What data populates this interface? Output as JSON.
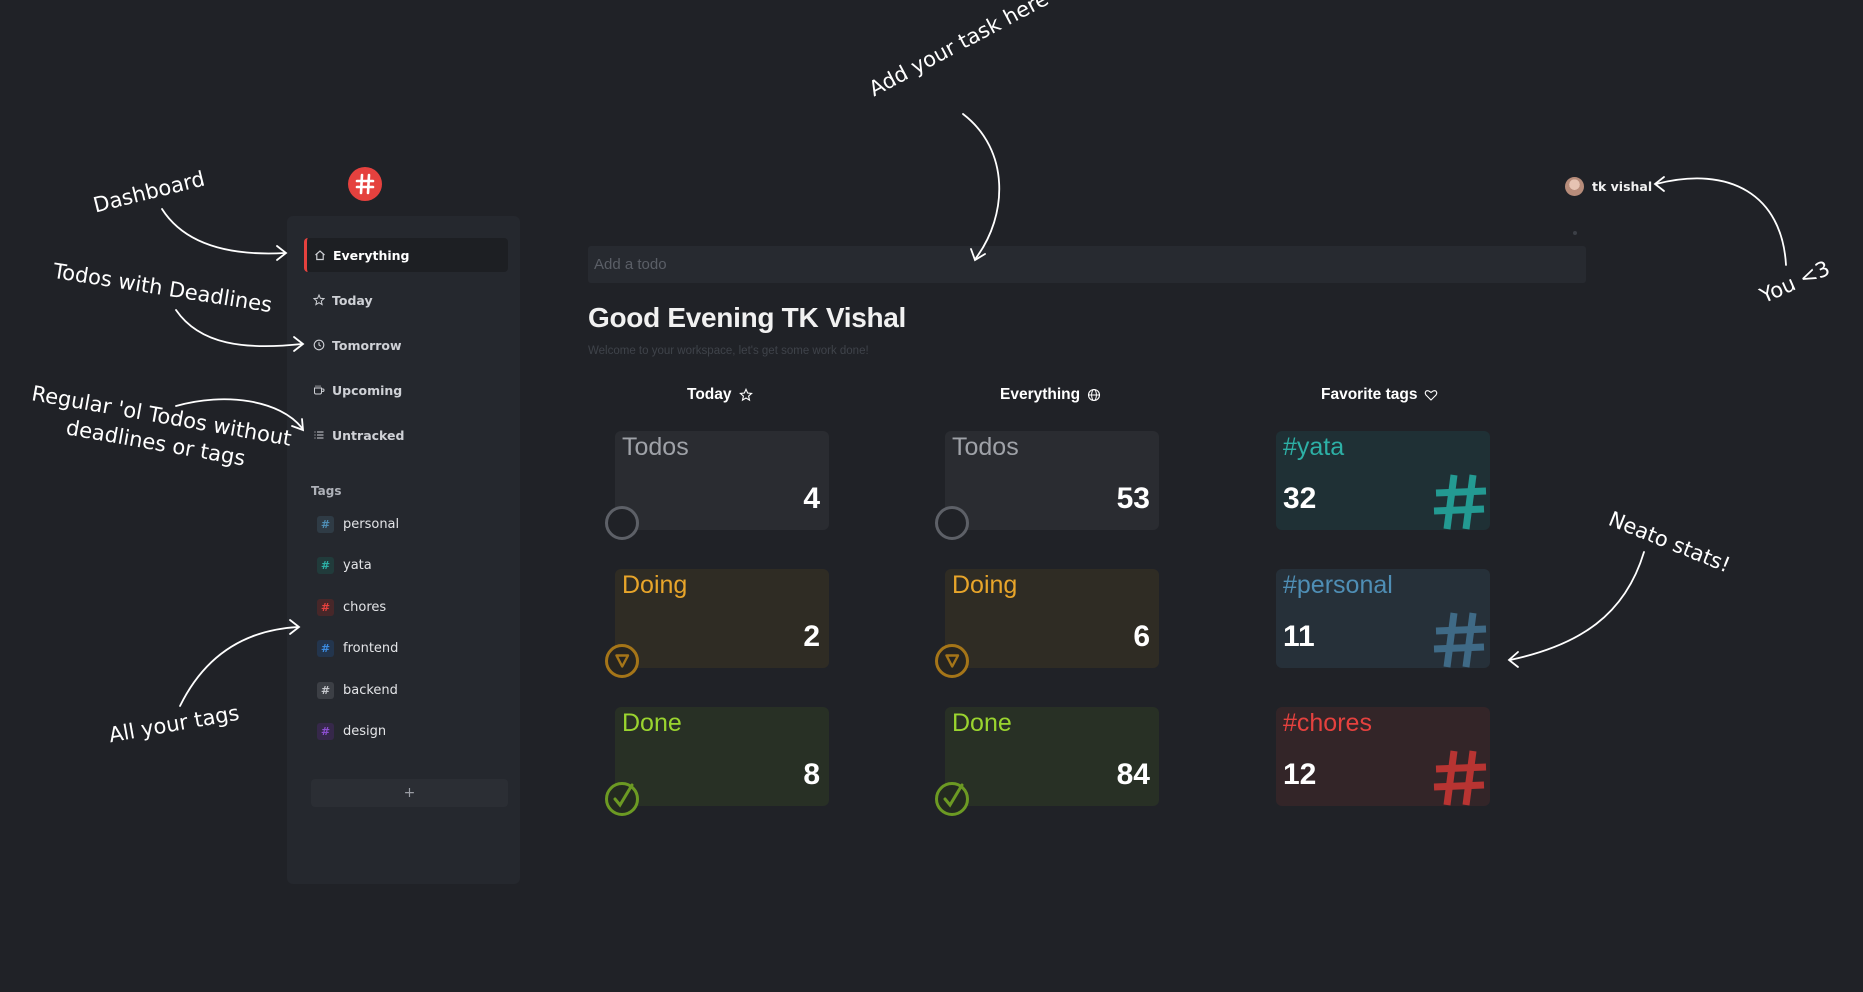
{
  "app": {
    "logo_icon": "hash-logo-icon",
    "accent": "#e5413e"
  },
  "sidebar": {
    "nav": [
      {
        "label": "Everything",
        "icon": "home-icon",
        "active": true
      },
      {
        "label": "Today",
        "icon": "star-icon"
      },
      {
        "label": "Tomorrow",
        "icon": "clock-icon"
      },
      {
        "label": "Upcoming",
        "icon": "cup-icon"
      },
      {
        "label": "Untracked",
        "icon": "list-icon"
      }
    ],
    "tags_heading": "Tags",
    "tags": [
      {
        "label": "personal",
        "color": "#4f8eb5"
      },
      {
        "label": "yata",
        "color": "#2db0a6"
      },
      {
        "label": "chores",
        "color": "#e5413e"
      },
      {
        "label": "frontend",
        "color": "#3b8be0"
      },
      {
        "label": "backend",
        "color": "#9a9da4"
      },
      {
        "label": "design",
        "color": "#8c4fd0"
      }
    ],
    "add_tag_label": "+"
  },
  "main": {
    "todo_placeholder": "Add a todo",
    "greeting": "Good Evening TK Vishal",
    "subtitle": "Welcome to your workspace, let's get some work done!",
    "user_name": "tk vishal",
    "columns": {
      "today": {
        "heading": "Today",
        "icon": "star-icon",
        "cards": [
          {
            "title": "Todos",
            "value": "4"
          },
          {
            "title": "Doing",
            "value": "2"
          },
          {
            "title": "Done",
            "value": "8"
          }
        ]
      },
      "everything": {
        "heading": "Everything",
        "icon": "globe-icon",
        "cards": [
          {
            "title": "Todos",
            "value": "53"
          },
          {
            "title": "Doing",
            "value": "6"
          },
          {
            "title": "Done",
            "value": "84"
          }
        ]
      },
      "favorites": {
        "heading": "Favorite tags",
        "icon": "heart-icon",
        "cards": [
          {
            "title": "#yata",
            "value": "32",
            "color": "#2db0a6"
          },
          {
            "title": "#personal",
            "value": "11",
            "color": "#4f8eb5"
          },
          {
            "title": "#chores",
            "value": "12",
            "color": "#e5413e"
          }
        ]
      }
    },
    "status_colors": {
      "todos": "#9fa2a8",
      "doing": "#e8a52a",
      "done": "#9ad42f"
    }
  },
  "annotations": {
    "dashboard": "Dashboard",
    "deadlines": "Todos with Deadlines",
    "regular_line1": "Regular 'ol Todos without",
    "regular_line2": "deadlines or tags",
    "tags": "All your tags",
    "add_task": "Add your task here",
    "you": "You <3",
    "stats": "Neato stats!"
  }
}
